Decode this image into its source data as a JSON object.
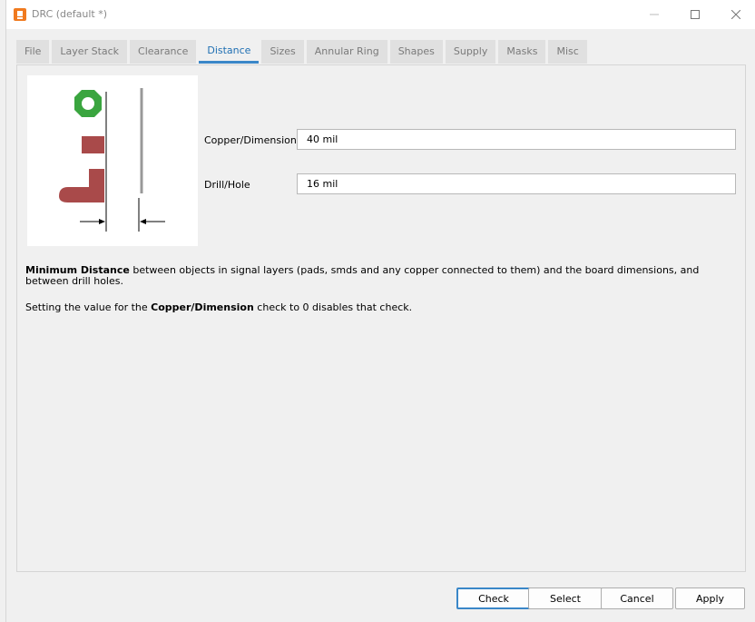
{
  "window": {
    "title": "DRC (default *)",
    "colors": {
      "accent": "#3a87c8",
      "pad_green": "#3aa53f",
      "copper_red": "#a94a4a",
      "dimension_gray": "#999999"
    }
  },
  "tabs": [
    {
      "label": "File"
    },
    {
      "label": "Layer Stack"
    },
    {
      "label": "Clearance"
    },
    {
      "label": "Distance",
      "active": true
    },
    {
      "label": "Sizes"
    },
    {
      "label": "Annular Ring"
    },
    {
      "label": "Shapes"
    },
    {
      "label": "Supply"
    },
    {
      "label": "Masks"
    },
    {
      "label": "Misc"
    }
  ],
  "form": {
    "copper_dimension": {
      "label": "Copper/Dimension",
      "value": "40 mil"
    },
    "drill_hole": {
      "label": "Drill/Hole",
      "value": "16 mil"
    }
  },
  "description": {
    "p1_bold": "Minimum Distance",
    "p1_rest": " between objects in signal layers (pads, smds and any copper connected to them) and the board dimensions, and between drill holes.",
    "p2_prefix": "Setting the value for the ",
    "p2_bold": "Copper/Dimension",
    "p2_suffix": " check to 0 disables that check."
  },
  "buttons": {
    "check": "Check",
    "select": "Select",
    "cancel": "Cancel",
    "apply": "Apply"
  }
}
